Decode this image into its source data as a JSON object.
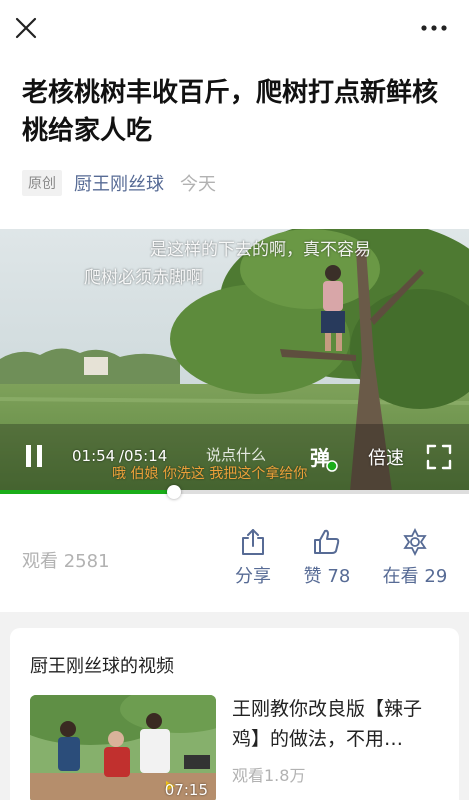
{
  "topbar": {
    "close_icon": "close-icon",
    "more_icon": "more-icon"
  },
  "article": {
    "title": "老核桃树丰收百斤，爬树打点新鲜核桃给家人吃",
    "badge": "原创",
    "author": "厨王刚丝球",
    "time": "今天"
  },
  "video": {
    "danmaku": [
      "是这样的下去的啊，真不容易",
      "爬树必须赤脚啊"
    ],
    "subtitle": "哦 伯娘 你洗这 我把这个拿给你",
    "current_time": "01:54",
    "duration": "/05:14",
    "comment_placeholder": "说点什么",
    "danmaku_toggle": "弹",
    "speed_label": "倍速",
    "progress": 0.37
  },
  "stats": {
    "views": "观看 2581",
    "share": "分享",
    "like": "赞 78",
    "watching": "在看 29"
  },
  "related": {
    "section_title": "厨王刚丝球的视频",
    "item": {
      "title": "王刚教你改良版【辣子鸡】的做法，不用…",
      "views": "观看1.8万",
      "duration": "07:15"
    }
  },
  "colors": {
    "accent": "#1aad19",
    "link": "#576b95",
    "muted": "#b2b2b2"
  }
}
